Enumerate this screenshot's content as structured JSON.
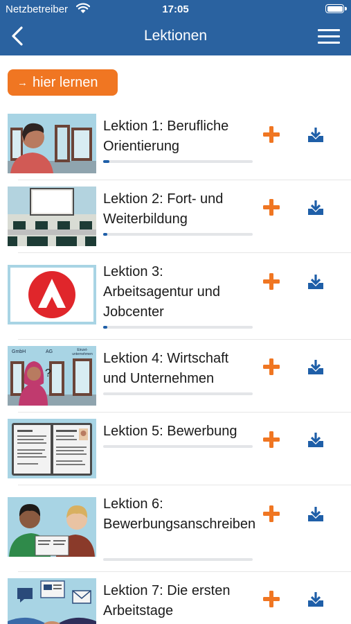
{
  "status_bar": {
    "carrier": "Netzbetreiber",
    "time": "17:05"
  },
  "nav": {
    "title": "Lektionen"
  },
  "learn_button": {
    "label": "hier lernen",
    "arrow": "→"
  },
  "colors": {
    "header": "#2a62a0",
    "accent_orange": "#f07622",
    "progress": "#1f5fa8",
    "icon_blue": "#1f5fa8"
  },
  "lessons": [
    {
      "title": "Lektion 1: Berufliche Orientierung",
      "progress": 0.04
    },
    {
      "title": "Lektion 2: Fort- und Weiterbildung",
      "progress": 0.03
    },
    {
      "title": "Lektion 3: Arbeitsagentur und Jobcenter",
      "progress": 0.03
    },
    {
      "title": "Lektion 4: Wirtschaft und Unternehmen",
      "progress": 0.0,
      "thumb_labels": [
        "GmbH",
        "AG",
        "Einzel-unternehmen"
      ]
    },
    {
      "title": "Lektion 5: Bewerbung",
      "progress": 0.0
    },
    {
      "title": "Lektion 6: Bewerbungsanschreiben",
      "progress": 0.0
    },
    {
      "title": "Lektion 7: Die ersten Arbeitstage",
      "progress": 0.0
    }
  ],
  "icons": {
    "add": "plus-icon",
    "download": "download-icon",
    "back": "chevron-left-icon",
    "menu": "hamburger-menu-icon"
  }
}
